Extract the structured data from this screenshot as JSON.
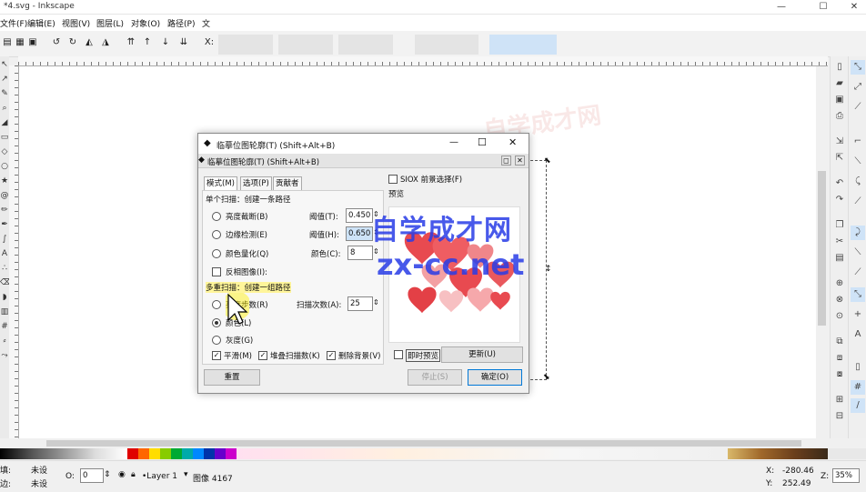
{
  "window": {
    "title": "*4.svg - Inkscape",
    "min": "—",
    "max": "☐",
    "close": "✕"
  },
  "menus": [
    "文件(F)",
    "编辑(E)",
    "视图(V)",
    "图层(L)",
    "对象(O)",
    "路径(P)",
    "文"
  ],
  "toolbar": {
    "x_label": "X:"
  },
  "dialog": {
    "title": "临摹位图轮廓(T) (Shift+Alt+B)",
    "subtitle": "临摹位图轮廓(T) (Shift+Alt+B)",
    "tabs": [
      "模式(M)",
      "选项(P)",
      "贡献者"
    ],
    "single_scan_header": "单个扫描：创建一条路径",
    "brightness": {
      "label": "亮度截断(B)",
      "threshold_label": "阈值(T):",
      "value": "0.450"
    },
    "edge": {
      "label": "边缘检测(E)",
      "threshold_label": "阈值(H):",
      "value": "0.650"
    },
    "quant": {
      "label": "颜色量化(Q)",
      "colors_label": "颜色(C):",
      "value": "8"
    },
    "invert": "反相图像(I):",
    "multi_scan_header": "多重扫描：创建一组路径",
    "steps": {
      "label": "亮度步数(R)",
      "scans_label": "扫描次数(A):",
      "value": "25"
    },
    "colors_option": "颜色(L)",
    "gray_option": "灰度(G)",
    "smooth": "平滑(M)",
    "stack": "堆叠扫描数(K)",
    "remove_bg": "删除背景(V)",
    "reset": "重置",
    "siox": "SIOX 前景选择(F)",
    "preview_label": "预览",
    "live_preview": "即时预览",
    "update": "更新(U)",
    "stop": "停止(S)",
    "ok": "确定(O)"
  },
  "watermark": {
    "line1": "自学成才网",
    "line2": "zx-cc.net"
  },
  "status": {
    "fill_label": "填:",
    "fill_value": "未设",
    "stroke_label": "边:",
    "stroke_value": "未设",
    "opacity_label": "O:",
    "opacity_value": "0",
    "layer": "•Layer 1",
    "msg": "图像 4167",
    "x_label": "X:",
    "x_value": "-280.46",
    "y_label": "Y:",
    "y_value": "252.49",
    "zoom_label": "Z:",
    "zoom_value": "35%"
  },
  "colors": {
    "accent": "#cfe3f7",
    "heart": "#e84a50"
  }
}
